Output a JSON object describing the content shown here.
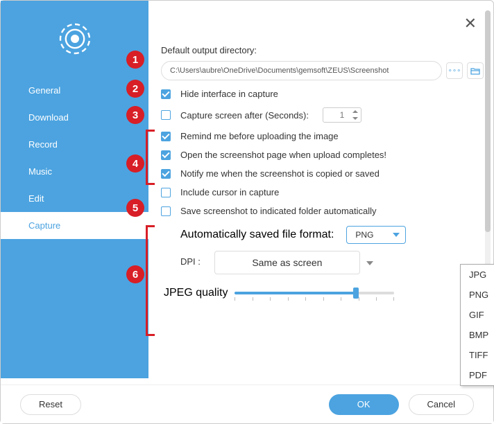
{
  "sidebar": {
    "items": [
      {
        "label": "General"
      },
      {
        "label": "Download"
      },
      {
        "label": "Record"
      },
      {
        "label": "Music"
      },
      {
        "label": "Edit"
      },
      {
        "label": "Capture"
      }
    ],
    "active_index": 5
  },
  "content": {
    "default_dir_label": "Default output directory:",
    "default_dir_value": "C:\\Users\\aubre\\OneDrive\\Documents\\gemsoft\\ZEUS\\Screenshot",
    "hide_interface": {
      "checked": true,
      "label": "Hide interface in capture"
    },
    "capture_after": {
      "checked": false,
      "label": "Capture screen after (Seconds):",
      "value": "1"
    },
    "remind_upload": {
      "checked": true,
      "label": "Remind me before uploading the image"
    },
    "open_page": {
      "checked": true,
      "label": "Open the screenshot page when upload completes!"
    },
    "notify_copy": {
      "checked": true,
      "label": "Notify me when the screenshot is copied or saved"
    },
    "include_cursor": {
      "checked": false,
      "label": "Include cursor in capture"
    },
    "auto_save": {
      "checked": false,
      "label": "Save screenshot to indicated folder automatically"
    },
    "format_label": "Automatically saved file format:",
    "format_value": "PNG",
    "format_options": [
      "JPG",
      "PNG",
      "GIF",
      "BMP",
      "TIFF",
      "PDF"
    ],
    "dpi_label": "DPI :",
    "dpi_value": "Same as screen",
    "jpeg_label": "JPEG quality",
    "jpeg_value": ""
  },
  "footer": {
    "reset": "Reset",
    "ok": "OK",
    "cancel": "Cancel"
  },
  "annotations": [
    "1",
    "2",
    "3",
    "4",
    "5",
    "6"
  ]
}
